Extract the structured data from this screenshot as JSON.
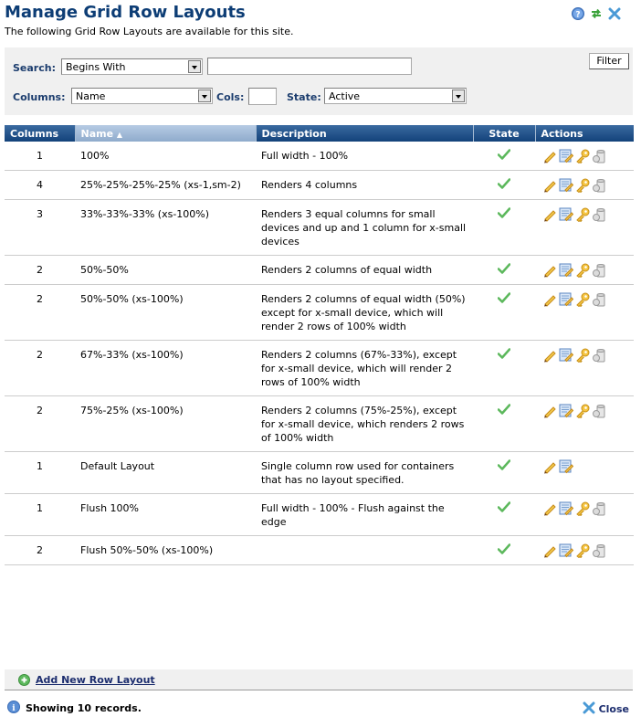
{
  "header": {
    "title": "Manage Grid Row Layouts",
    "subtitle": "The following Grid Row Layouts are available for this site.",
    "icons": [
      "help-icon",
      "refresh-icon",
      "close-icon"
    ]
  },
  "filter": {
    "search_label": "Search:",
    "search_mode": "Begins With",
    "search_value": "",
    "columns_label": "Columns:",
    "columns_value": "Name",
    "cols_label": "Cols:",
    "cols_value": "",
    "state_label": "State:",
    "state_value": "Active",
    "filter_button": "Filter"
  },
  "table": {
    "headers": {
      "columns": "Columns",
      "name": "Name",
      "description": "Description",
      "state": "State",
      "actions": "Actions"
    },
    "sort": {
      "column": "name",
      "direction": "ascending"
    },
    "rows": [
      {
        "columns": "1",
        "name": "100%",
        "description": "Full width - 100%",
        "state": "active",
        "actions": [
          "edit",
          "edit-details",
          "permissions",
          "delete"
        ]
      },
      {
        "columns": "4",
        "name": "25%-25%-25%-25% (xs-1,sm-2)",
        "description": "Renders 4 columns",
        "state": "active",
        "actions": [
          "edit",
          "edit-details",
          "permissions",
          "delete"
        ]
      },
      {
        "columns": "3",
        "name": "33%-33%-33% (xs-100%)",
        "description": "Renders 3 equal columns for small devices and up and 1 column for x-small devices",
        "state": "active",
        "actions": [
          "edit",
          "edit-details",
          "permissions",
          "delete"
        ]
      },
      {
        "columns": "2",
        "name": "50%-50%",
        "description": "Renders 2 columns of equal width",
        "state": "active",
        "actions": [
          "edit",
          "edit-details",
          "permissions",
          "delete"
        ]
      },
      {
        "columns": "2",
        "name": "50%-50% (xs-100%)",
        "description": "Renders 2 columns of equal width (50%) except for x-small device, which will render 2 rows of 100% width",
        "state": "active",
        "actions": [
          "edit",
          "edit-details",
          "permissions",
          "delete"
        ]
      },
      {
        "columns": "2",
        "name": "67%-33% (xs-100%)",
        "description": "Renders 2 columns (67%-33%), except for x-small device, which will render 2 rows of 100% width",
        "state": "active",
        "actions": [
          "edit",
          "edit-details",
          "permissions",
          "delete"
        ]
      },
      {
        "columns": "2",
        "name": "75%-25% (xs-100%)",
        "description": "Renders 2 columns (75%-25%), except for x-small device, which renders 2 rows of 100% width",
        "state": "active",
        "actions": [
          "edit",
          "edit-details",
          "permissions",
          "delete"
        ]
      },
      {
        "columns": "1",
        "name": "Default Layout",
        "description": "Single column row used for containers that has no layout specified.",
        "state": "active",
        "actions": [
          "edit",
          "edit-details"
        ]
      },
      {
        "columns": "1",
        "name": "Flush 100%",
        "description": "Full width - 100% - Flush against the edge",
        "state": "active",
        "actions": [
          "edit",
          "edit-details",
          "permissions",
          "delete"
        ]
      },
      {
        "columns": "2",
        "name": "Flush 50%-50% (xs-100%)",
        "description": "",
        "state": "active",
        "actions": [
          "edit",
          "edit-details",
          "permissions",
          "delete"
        ]
      }
    ]
  },
  "footer": {
    "add_label": "Add New Row Layout",
    "status": "Showing 10 records.",
    "close_label": "Close"
  },
  "colors": {
    "title": "#0d3d75",
    "header_bg": "#13427a",
    "sorted_header_bg": "#a3bcda",
    "panel_bg": "#f0f0f0",
    "check": "#5cb85c",
    "link": "#1c2d6e"
  }
}
